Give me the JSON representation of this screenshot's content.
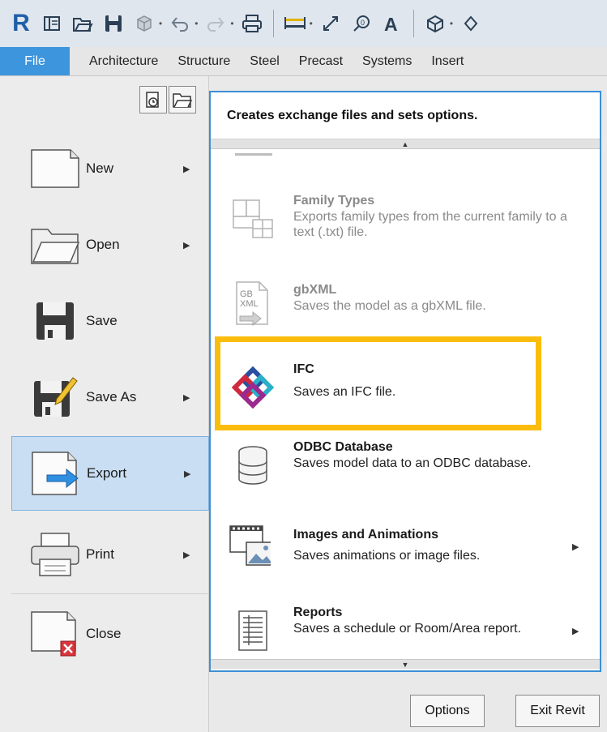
{
  "qat": {
    "logo": "R",
    "icons": [
      "recent-files-icon",
      "open-folder-icon",
      "save-icon",
      "cube-icon",
      "undo-icon",
      "redo-icon",
      "print-icon",
      "measure-icon",
      "dimension-icon",
      "tag-icon",
      "text-icon",
      "3d-view-icon"
    ]
  },
  "tabs": [
    "File",
    "Architecture",
    "Structure",
    "Steel",
    "Precast",
    "Systems",
    "Insert"
  ],
  "menu": [
    {
      "label": "New",
      "arrow": "▶"
    },
    {
      "label": "Open",
      "arrow": "▶"
    },
    {
      "label": "Save",
      "arrow": ""
    },
    {
      "label": "Save As",
      "arrow": "▶"
    },
    {
      "label": "Export",
      "arrow": "▶",
      "active": true
    },
    {
      "label": "Print",
      "arrow": "▶"
    },
    {
      "label": "Close",
      "arrow": ""
    }
  ],
  "panel": {
    "header": "Creates exchange files and sets options.",
    "scroll_up": "▲",
    "scroll_down": "▼",
    "entries": [
      {
        "title": "Family Types",
        "desc": "Exports family types from the current family to a text (.txt) file.",
        "disabled": true
      },
      {
        "title": "gbXML",
        "desc": "Saves the model as a gbXML file.",
        "disabled": true,
        "icon_text": "GB XML"
      },
      {
        "title": "IFC",
        "desc": "Saves an IFC file.",
        "disabled": false
      },
      {
        "title": "ODBC Database",
        "desc": "Saves model data to an ODBC database.",
        "disabled": false
      },
      {
        "title": "Images and Animations",
        "desc": "Saves animations or image files.",
        "disabled": false,
        "arrow": "▶"
      },
      {
        "title": "Reports",
        "desc": "Saves a schedule or Room/Area report.",
        "disabled": false,
        "arrow": "▶"
      }
    ]
  },
  "buttons": {
    "options": "Options",
    "exit": "Exit Revit"
  },
  "colors": {
    "file_tab": "#3d95dd",
    "highlight": "#fbbd0d",
    "active_item": "#c9def3",
    "panel_border": "#3c8fd6"
  }
}
